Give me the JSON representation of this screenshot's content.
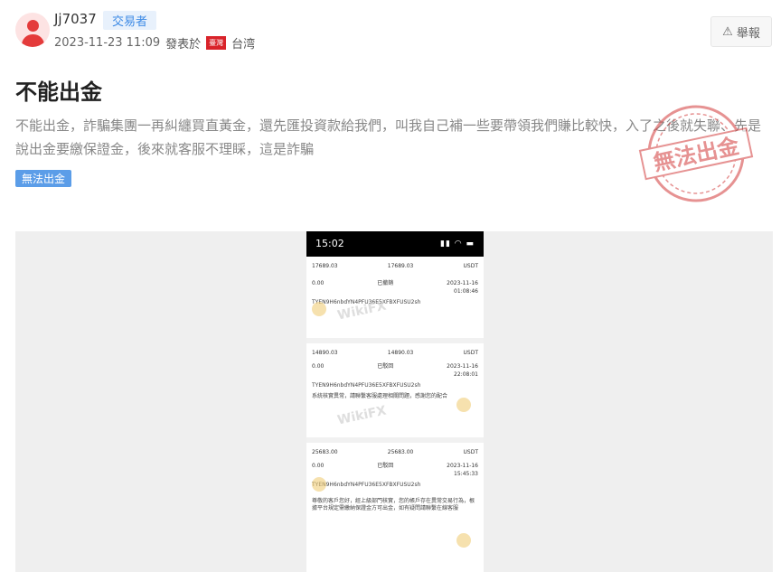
{
  "author": {
    "name": "Jj7037",
    "role": "交易者",
    "timestamp": "2023-11-23 11:09",
    "posted_from_label": "發表於",
    "location": "台湾",
    "flag_text": "臺灣"
  },
  "actions": {
    "report_label": "舉報"
  },
  "post": {
    "title": "不能出金",
    "body": "不能出金，詐騙集團一再糾纏買直黃金，還先匯投資款給我們，叫我自己補一些要帶領我們賺比較快，入了之後就失聯、先是說出金要繳保證金，後來就客服不理睬，這是詐騙",
    "tag": "無法出金"
  },
  "stamp": {
    "text": "無法出金"
  },
  "screenshot": {
    "status_time": "15:02",
    "watermark": "WikiFX",
    "cards": [
      {
        "r1": [
          "17689.03",
          "17689.03",
          "USDT"
        ],
        "r2": [
          "0.00",
          "已撤銷",
          "2023-11-16"
        ],
        "r3": [
          "",
          "",
          "01:08:46"
        ],
        "addr": "TYEN9H6nbdYN4PFU36E5XFBXFUSU2sh"
      },
      {
        "r1": [
          "14890.03",
          "14890.03",
          "USDT"
        ],
        "r2": [
          "0.00",
          "已駁回",
          "2023-11-16"
        ],
        "r3": [
          "",
          "",
          "22:08:01"
        ],
        "addr": "TYEN9H6nbdYN4PFU36E5XFBXFUSU2sh",
        "note": "系統核實異常，請聯繫客服處理相關問題，感謝您的配合"
      },
      {
        "r1": [
          "25683.00",
          "25683.00",
          "USDT"
        ],
        "r2": [
          "0.00",
          "已駁回",
          "2023-11-16"
        ],
        "r3": [
          "",
          "",
          "15:45:33"
        ],
        "addr": "TYEN9H6nbdYN4PFU36E5XFBXFUSU2sh",
        "note": "尊敬的客戶您好，經上級部門核實，您的帳戶存在異常交易行為，根據平台規定需繳納保證金方可出金，如有疑問請聯繫在線客服"
      }
    ]
  }
}
